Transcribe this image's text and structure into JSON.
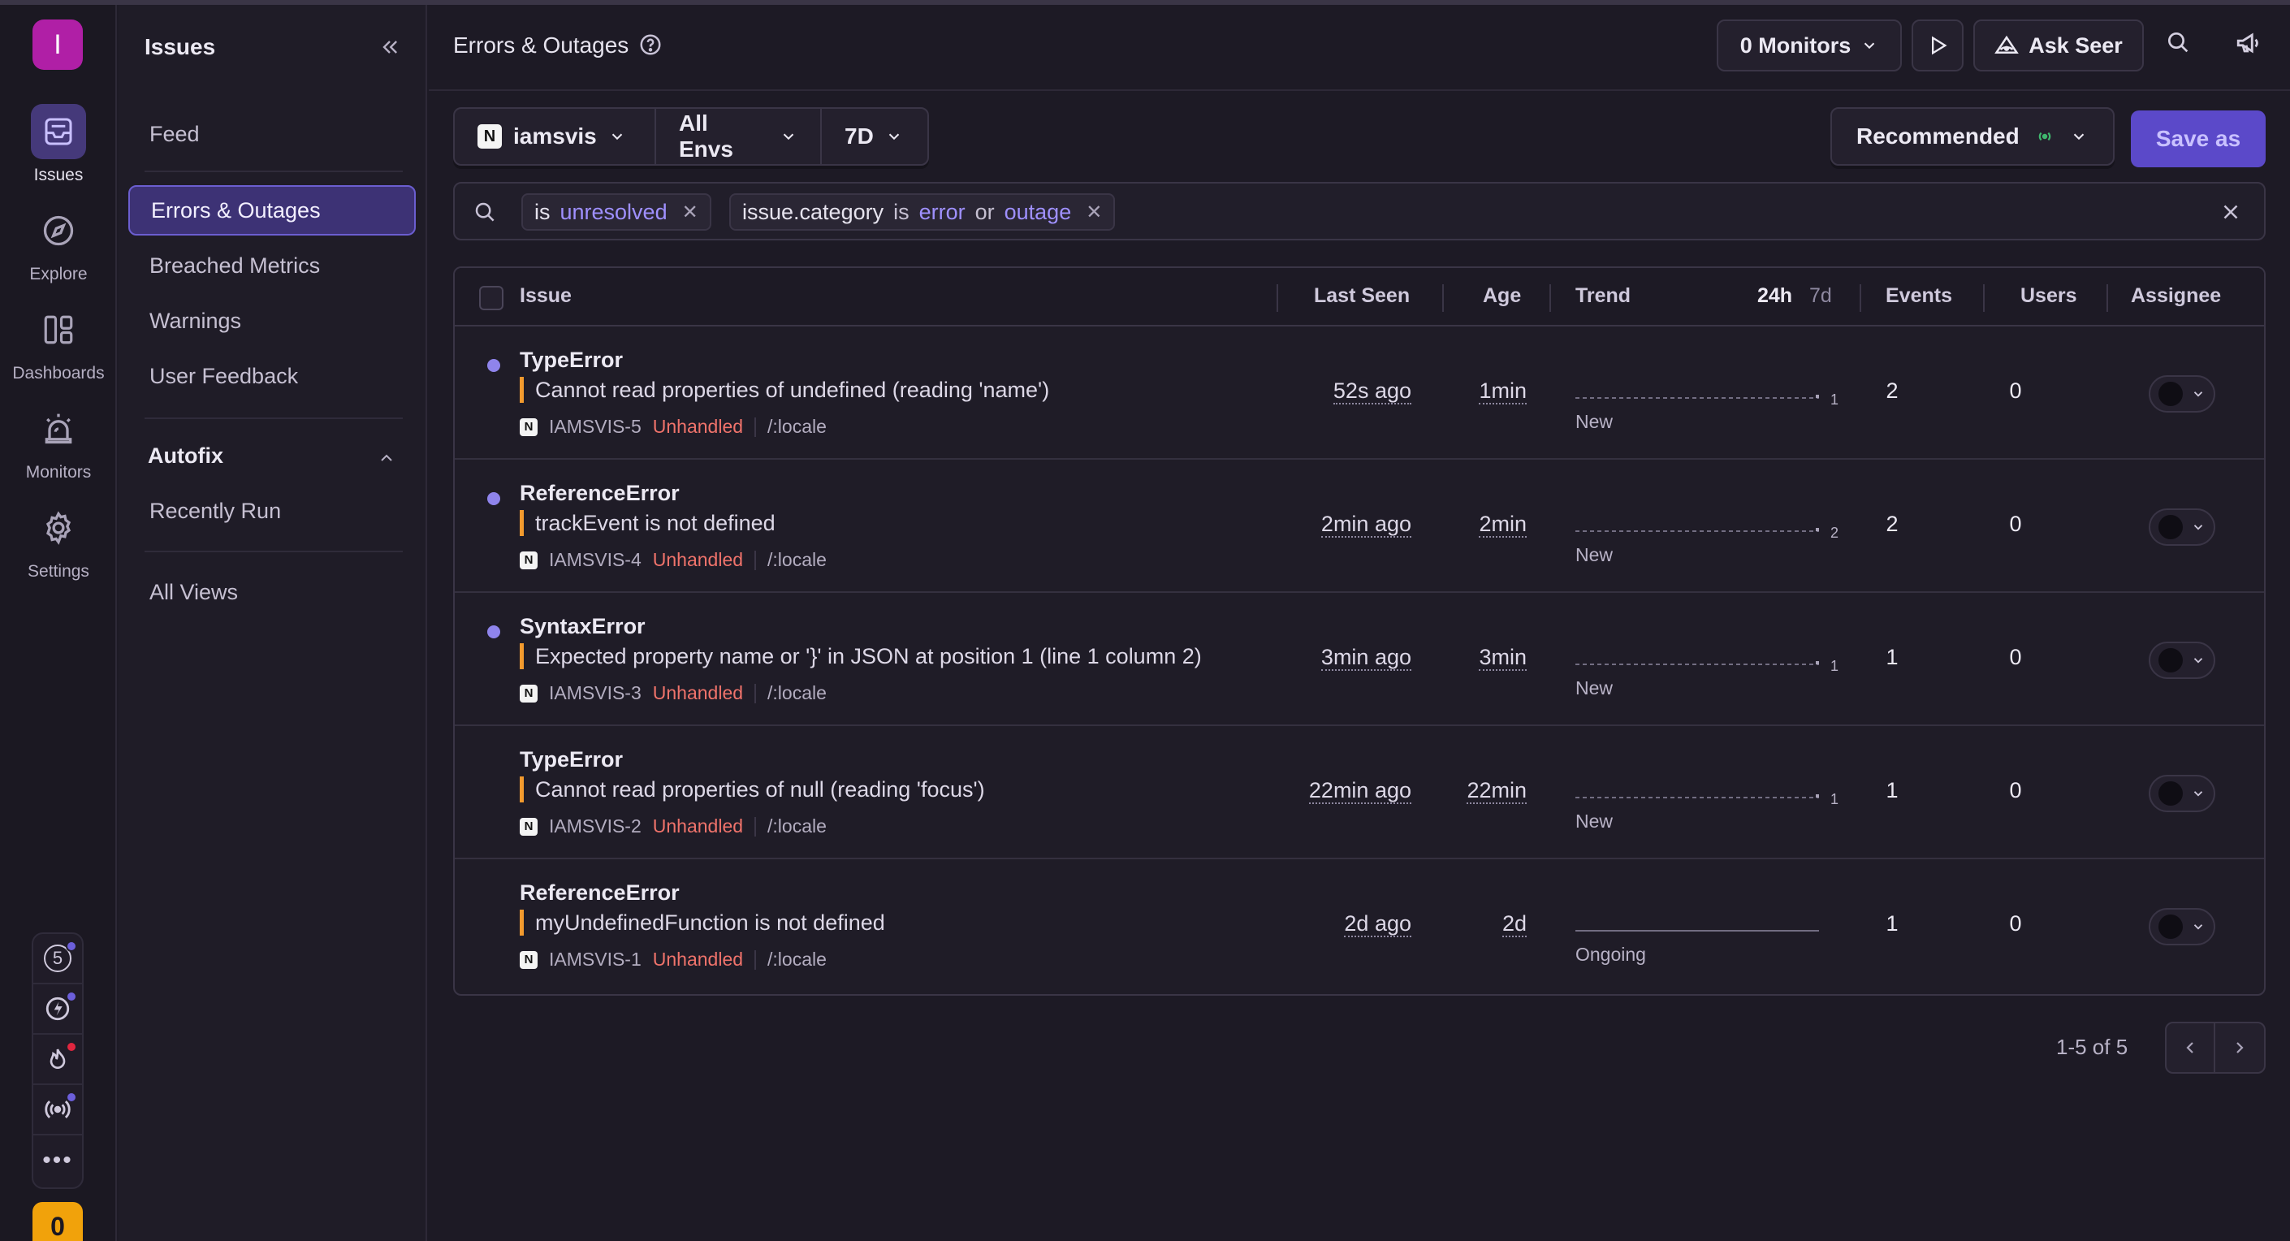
{
  "org": {
    "initial": "I",
    "color": "#b01fa6"
  },
  "rail": {
    "items": [
      {
        "label": "Issues",
        "icon": "inbox-icon",
        "active": true
      },
      {
        "label": "Explore",
        "icon": "compass-icon",
        "active": false
      },
      {
        "label": "Dashboards",
        "icon": "dashboard-icon",
        "active": false
      },
      {
        "label": "Monitors",
        "icon": "siren-icon",
        "active": false
      },
      {
        "label": "Settings",
        "icon": "gear-icon",
        "active": false
      }
    ],
    "stack": [
      {
        "icon": "badge-5-icon",
        "text": "5"
      },
      {
        "icon": "lightning-icon"
      },
      {
        "icon": "flame-icon"
      },
      {
        "icon": "broadcast-icon"
      },
      {
        "icon": "more-icon"
      }
    ],
    "onboarding_count": "0"
  },
  "sidebar": {
    "title": "Issues",
    "items": [
      {
        "label": "Feed"
      },
      {
        "label": "Errors & Outages",
        "active": true
      },
      {
        "label": "Breached Metrics"
      },
      {
        "label": "Warnings"
      },
      {
        "label": "User Feedback"
      }
    ],
    "section": "Autofix",
    "section_items": [
      {
        "label": "Recently Run"
      }
    ],
    "footer_items": [
      {
        "label": "All Views"
      }
    ]
  },
  "header": {
    "title": "Errors & Outages",
    "monitors_label": "0 Monitors",
    "ask_seer_label": "Ask Seer"
  },
  "filters": {
    "project": "iamsvis",
    "project_icon": "N",
    "env": "All Envs",
    "range": "7D",
    "sort": "Recommended",
    "save_as": "Save as"
  },
  "search": {
    "tokens": [
      {
        "key": "is",
        "op": "",
        "values": [
          "unresolved"
        ]
      },
      {
        "key": "issue.category",
        "op": "is",
        "values": [
          "error",
          "outage"
        ],
        "joiner": "or"
      }
    ]
  },
  "table": {
    "columns": {
      "issue": "Issue",
      "last_seen": "Last Seen",
      "age": "Age",
      "trend": "Trend",
      "period_24h": "24h",
      "period_7d": "7d",
      "events": "Events",
      "users": "Users",
      "assignee": "Assignee"
    },
    "rows": [
      {
        "type": "TypeError",
        "message": "Cannot read properties of undefined (reading 'name')",
        "short_id": "IAMSVIS-5",
        "handled": "Unhandled",
        "culprit": "/:locale",
        "last_seen": "52s ago",
        "age": "1min",
        "trend_label": "New",
        "trend_max": "1",
        "events": "2",
        "users": "0",
        "unread": true
      },
      {
        "type": "ReferenceError",
        "message": "trackEvent is not defined",
        "short_id": "IAMSVIS-4",
        "handled": "Unhandled",
        "culprit": "/:locale",
        "last_seen": "2min ago",
        "age": "2min",
        "trend_label": "New",
        "trend_max": "2",
        "events": "2",
        "users": "0",
        "unread": true
      },
      {
        "type": "SyntaxError",
        "message": "Expected property name or '}' in JSON at position 1 (line 1 column 2)",
        "short_id": "IAMSVIS-3",
        "handled": "Unhandled",
        "culprit": "/:locale",
        "last_seen": "3min ago",
        "age": "3min",
        "trend_label": "New",
        "trend_max": "1",
        "events": "1",
        "users": "0",
        "unread": true
      },
      {
        "type": "TypeError",
        "message": "Cannot read properties of null (reading 'focus')",
        "short_id": "IAMSVIS-2",
        "handled": "Unhandled",
        "culprit": "/:locale",
        "last_seen": "22min ago",
        "age": "22min",
        "trend_label": "New",
        "trend_max": "1",
        "events": "1",
        "users": "0",
        "unread": false
      },
      {
        "type": "ReferenceError",
        "message": "myUndefinedFunction is not defined",
        "short_id": "IAMSVIS-1",
        "handled": "Unhandled",
        "culprit": "/:locale",
        "last_seen": "2d ago",
        "age": "2d",
        "trend_label": "Ongoing",
        "trend_max": "",
        "events": "1",
        "users": "0",
        "unread": false
      }
    ]
  },
  "pagination": {
    "text": "1-5 of 5"
  },
  "colors": {
    "accent": "#5b49c9",
    "unhandled": "#f0736b",
    "level_bar": "#f29a2e",
    "unread": "#8f84ec"
  }
}
